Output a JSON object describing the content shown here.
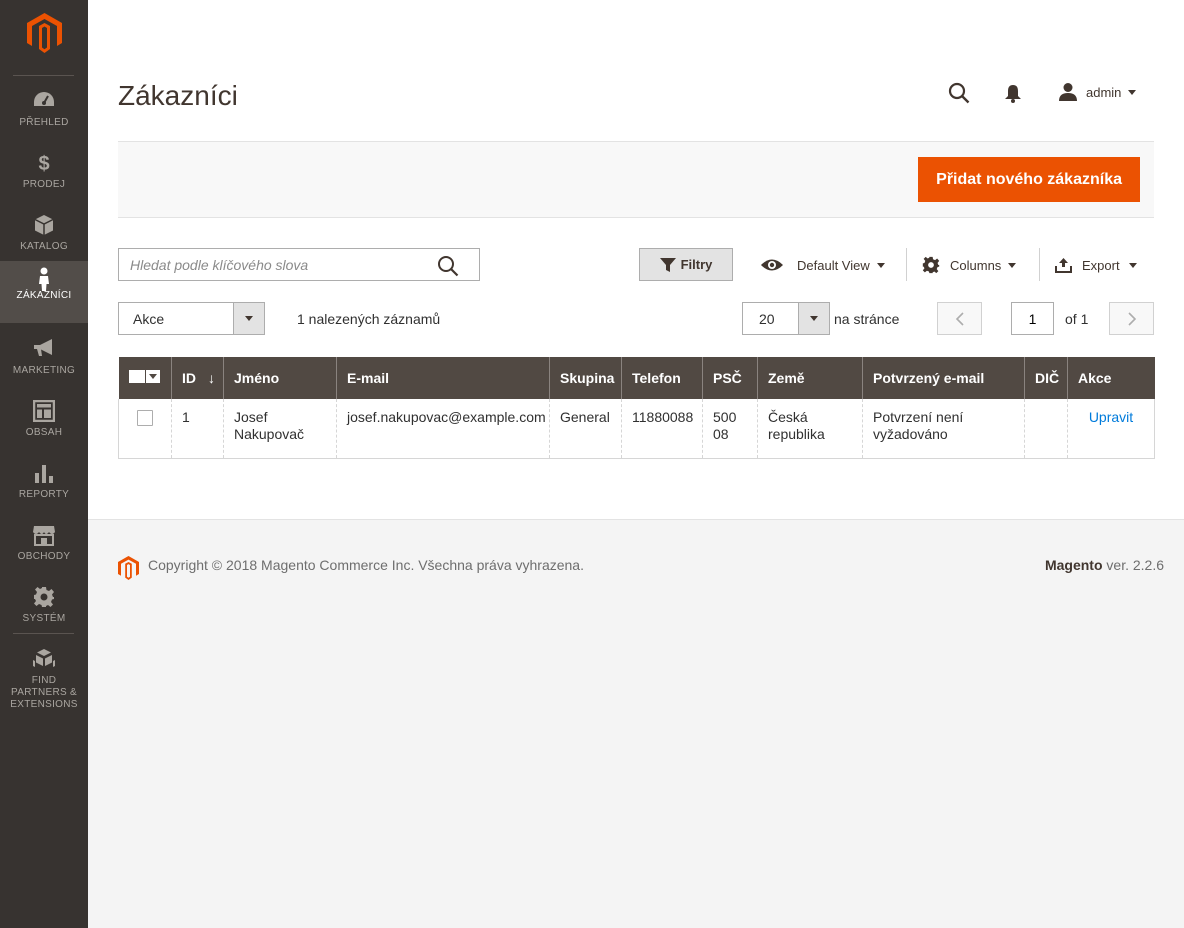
{
  "sidebar": {
    "items": [
      {
        "label": "PŘEHLED",
        "icon": "dashboard-icon"
      },
      {
        "label": "PRODEJ",
        "icon": "dollar-icon"
      },
      {
        "label": "KATALOG",
        "icon": "cube-icon"
      },
      {
        "label": "ZÁKAZNÍCI",
        "icon": "person-icon",
        "active": true
      },
      {
        "label": "MARKETING",
        "icon": "megaphone-icon"
      },
      {
        "label": "OBSAH",
        "icon": "layout-icon"
      },
      {
        "label": "REPORTY",
        "icon": "bar-chart-icon"
      },
      {
        "label": "OBCHODY",
        "icon": "store-icon"
      },
      {
        "label": "SYSTÉM",
        "icon": "gear-icon"
      },
      {
        "label": "FIND PARTNERS & EXTENSIONS",
        "icon": "cubes-icon"
      }
    ]
  },
  "header": {
    "title": "Zákazníci",
    "user": "admin"
  },
  "actions": {
    "add_button": "Přidat nového zákazníka"
  },
  "toolbar": {
    "search_placeholder": "Hledat podle klíčového slova",
    "filters": "Filtry",
    "view": "Default View",
    "columns": "Columns",
    "export": "Export",
    "mass_action": "Akce",
    "records_found": "1 nalezených záznamů",
    "per_page": "20",
    "per_page_label": "na stránce",
    "current_page": "1",
    "total_pages": "of 1"
  },
  "grid": {
    "columns": [
      "ID",
      "Jméno",
      "E-mail",
      "Skupina",
      "Telefon",
      "PSČ",
      "Země",
      "Potvrzený e-mail",
      "DIČ",
      "Akce"
    ],
    "sort_indicator": "↓",
    "rows": [
      {
        "id": "1",
        "name": "Josef Nakupovač",
        "email": "josef.nakupovac@example.com",
        "group": "General",
        "phone": "11880088",
        "zip": "500 08",
        "country": "Česká republika",
        "confirmed": "Potvrzení není vyžadováno",
        "vat": "",
        "action": "Upravit"
      }
    ]
  },
  "footer": {
    "copyright": "Copyright © 2018 Magento Commerce Inc. Všechna práva vyhrazena.",
    "brand": "Magento",
    "version": "ver. 2.2.6"
  },
  "colors": {
    "sidebar_bg": "#373330",
    "accent": "#eb5202",
    "grid_header": "#514943",
    "link": "#007bdb"
  }
}
